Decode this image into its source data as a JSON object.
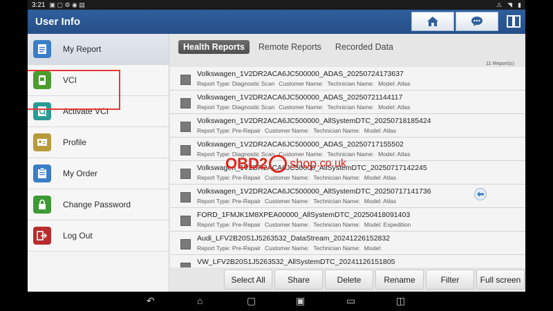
{
  "statusbar": {
    "time": "3:21"
  },
  "header": {
    "title": "User Info"
  },
  "sidebar": {
    "items": [
      {
        "label": "My Report",
        "icon": "report-icon",
        "color": "#3b7ec7"
      },
      {
        "label": "VCI",
        "icon": "vci-icon",
        "color": "#4e9b2e"
      },
      {
        "label": "Activate VCI",
        "icon": "activate-icon",
        "color": "#2a9a97"
      },
      {
        "label": "Profile",
        "icon": "profile-icon",
        "color": "#b79a3a"
      },
      {
        "label": "My Order",
        "icon": "order-icon",
        "color": "#3b7ec7"
      },
      {
        "label": "Change Password",
        "icon": "lock-icon",
        "color": "#3e9a35"
      },
      {
        "label": "Log Out",
        "icon": "logout-icon",
        "color": "#b72d2d"
      }
    ]
  },
  "tabs": [
    {
      "label": "Health Reports",
      "active": true
    },
    {
      "label": "Remote Reports",
      "active": false
    },
    {
      "label": "Recorded Data",
      "active": false
    }
  ],
  "report_count": "11 Report(s)",
  "reports": [
    {
      "name": "Volkswagen_1V2DR2ACA6JC500000_ADAS_20250724173637",
      "type": "Report Type: Diagnostic Scan",
      "customer": "Customer Name:",
      "technician": "Technician Name:",
      "model": "Model: Atlas"
    },
    {
      "name": "Volkswagen_1V2DR2ACA6JC500000_ADAS_20250721144117",
      "type": "Report Type: Diagnostic Scan",
      "customer": "Customer Name:",
      "technician": "Technician Name:",
      "model": "Model: Atlas"
    },
    {
      "name": "Volkswagen_1V2DR2ACA6JC500000_AllSystemDTC_20250718185424",
      "type": "Report Type: Pre-Repair",
      "customer": "Customer Name:",
      "technician": "Technician Name:",
      "model": "Model: Atlas"
    },
    {
      "name": "Volkswagen_1V2DR2ACA6JC500000_ADAS_20250717155502",
      "type": "Report Type: Diagnostic Scan",
      "customer": "Customer Name:",
      "technician": "Technician Name:",
      "model": "Model: Atlas"
    },
    {
      "name": "Volkswagen_1V2DR2ACA6JC50000_AllSystemDTC_20250717142245",
      "type": "Report Type: Pre-Repair",
      "customer": "Customer Name:",
      "technician": "Technician Name:",
      "model": "Model: Atlas"
    },
    {
      "name": "Volkswagen_1V2DR2ACA6JC500000_AllSystemDTC_20250717141736",
      "type": "Report Type: Pre-Repair",
      "customer": "Customer Name:",
      "technician": "Technician Name:",
      "model": "Model: Atlas"
    },
    {
      "name": "FORD_1FMJK1M8XPEA00000_AllSystemDTC_20250418091403",
      "type": "Report Type: Pre-Repair",
      "customer": "Customer Name:",
      "technician": "Technician Name:",
      "model": "Model: Expedition"
    },
    {
      "name": "Audi_LFV2B20S1J5263532_DataStream_20241226152832",
      "type": "Report Type: Pre-Repair",
      "customer": "Customer Name:",
      "technician": "Technician Name:",
      "model": "Model:"
    },
    {
      "name": "VW_LFV2B20S1J5263532_AllSystemDTC_20241126151805",
      "type": "",
      "customer": "",
      "technician": "",
      "model": ""
    }
  ],
  "toolbar": {
    "select_all": "Select All",
    "share": "Share",
    "delete": "Delete",
    "rename": "Rename",
    "filter": "Filter",
    "full_screen": "Full screen"
  },
  "watermark": {
    "obd": "OBD2",
    "shop": "shop",
    "couk": ".co.uk"
  },
  "colors": {
    "header": "#2f5f9c",
    "highlight": "#e53935"
  }
}
